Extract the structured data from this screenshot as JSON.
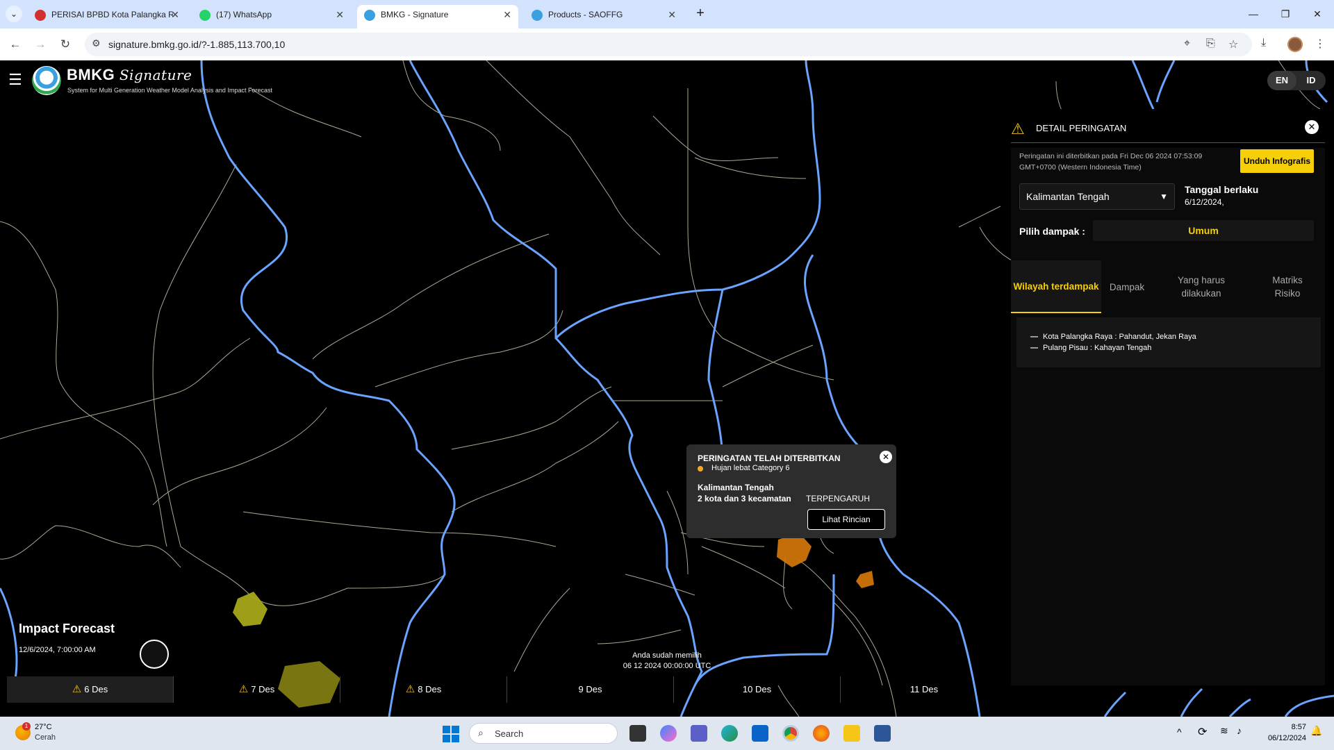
{
  "browser": {
    "tabs": [
      {
        "title": "PERISAI BPBD Kota Palangka Ra",
        "active": false,
        "favicon_color": "#d32f2f"
      },
      {
        "title": "(17) WhatsApp",
        "active": false,
        "favicon_color": "#25d366"
      },
      {
        "title": "BMKG - Signature",
        "active": true,
        "favicon_color": "#3aa0e0"
      },
      {
        "title": "Products - SAOFFG",
        "active": false,
        "favicon_color": "#3aa0e0"
      }
    ],
    "url": "signature.bmkg.go.id/?-1.885,113.700,10"
  },
  "app": {
    "logo_main": "BMKG",
    "logo_script": "Signature",
    "logo_subtitle": "System for Multi Generation Weather Model Analysis and Impact Forecast",
    "lang": {
      "en": "EN",
      "id": "ID",
      "selected": "ID"
    }
  },
  "popup": {
    "title": "PERINGATAN TELAH DITERBITKAN",
    "hazard": "Hujan lebat Category 6",
    "region": "Kalimantan Tengah",
    "affected": "2 kota dan  3 kecamatan",
    "affected_tag": "TERPENGARUH",
    "button": "Lihat Rincian"
  },
  "panel": {
    "title": "DETAIL PERINGATAN",
    "issued_text": "Peringatan ini diterbitkan pada Fri Dec 06 2024 07:53:09 GMT+0700 (Western Indonesia Time)",
    "download_button": "Unduh Infografis",
    "region_select": "Kalimantan Tengah",
    "valid_label": "Tanggal berlaku",
    "valid_value": "6/12/2024,",
    "impact_label": "Pilih dampak :",
    "impact_value": "Umum",
    "tabs": [
      {
        "label": "Wilayah terdampak",
        "active": true
      },
      {
        "label": "Dampak",
        "active": false
      },
      {
        "label": "Yang harus dilakukan",
        "active": false
      },
      {
        "label": "Matriks Risiko",
        "active": false
      }
    ],
    "affected_areas": [
      "Kota Palangka Raya : Pahandut, Jekan Raya",
      "Pulang Pisau : Kahayan Tengah"
    ]
  },
  "timeline": {
    "title": "Impact Forecast",
    "datetime": "12/6/2024, 7:00:00 AM",
    "days": [
      {
        "label": "6 Des",
        "warning": true,
        "active": true
      },
      {
        "label": "7 Des",
        "warning": true,
        "active": false
      },
      {
        "label": "8 Des",
        "warning": true,
        "active": false
      },
      {
        "label": "9 Des",
        "warning": false,
        "active": false
      },
      {
        "label": "10 Des",
        "warning": false,
        "active": false
      },
      {
        "label": "11 Des",
        "warning": false,
        "active": false
      }
    ],
    "status_line1": "Anda sudah memilih",
    "status_line2": "06 12 2024 00:00:00 UTC"
  },
  "taskbar": {
    "weather_temp": "27°C",
    "weather_condition": "Cerah",
    "weather_badge": "1",
    "search_placeholder": "Search",
    "time": "8:57",
    "date": "06/12/2024"
  },
  "colors": {
    "warning_yellow": "#f5c518",
    "accent_yellow": "#f5d00a",
    "hazard_orange": "#e07b00",
    "hazard_olive": "#9a9a10",
    "river_blue": "#6aa4ff"
  }
}
